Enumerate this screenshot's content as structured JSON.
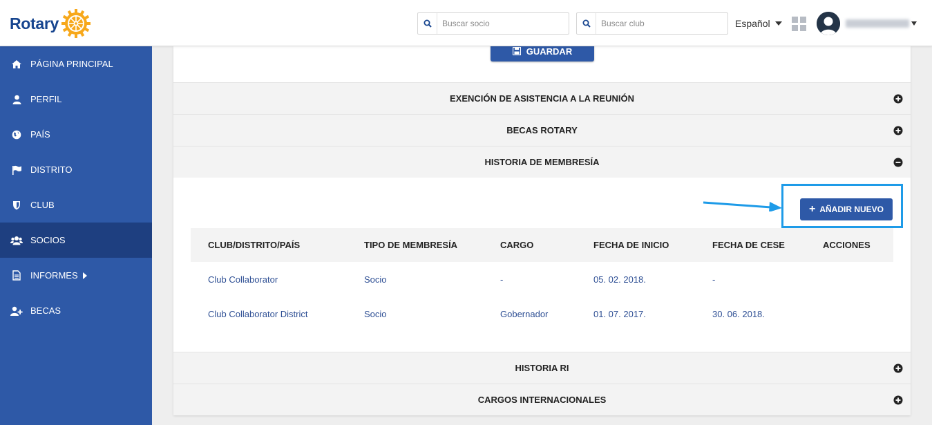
{
  "header": {
    "logo_text": "Rotary",
    "search_member_placeholder": "Buscar socio",
    "search_club_placeholder": "Buscar club",
    "language": "Español"
  },
  "sidebar": {
    "items": [
      {
        "label": "PÁGINA PRINCIPAL",
        "icon": "home-icon"
      },
      {
        "label": "PERFIL",
        "icon": "user-icon"
      },
      {
        "label": "PAÍS",
        "icon": "globe-icon"
      },
      {
        "label": "DISTRITO",
        "icon": "flag-icon"
      },
      {
        "label": "CLUB",
        "icon": "shield-icon"
      },
      {
        "label": "SOCIOS",
        "icon": "users-icon",
        "active": true
      },
      {
        "label": "INFORMES",
        "icon": "document-icon"
      },
      {
        "label": "BECAS",
        "icon": "user-plus-icon"
      }
    ]
  },
  "main": {
    "save_label": "GUARDAR",
    "sections": {
      "attendance": "EXENCIÓN DE ASISTENCIA A LA REUNIÓN",
      "grants": "BECAS ROTARY",
      "membership_history": "HISTORIA DE MEMBRESÍA",
      "ri_history": "HISTORIA RI",
      "international_roles": "CARGOS INTERNACIONALES"
    },
    "add_new_label": "AÑADIR NUEVO",
    "table": {
      "headers": [
        "CLUB/DISTRITO/PAÍS",
        "TIPO DE MEMBRESÍA",
        "CARGO",
        "FECHA DE INICIO",
        "FECHA DE CESE",
        "ACCIONES"
      ],
      "rows": [
        [
          "Club Collaborator",
          "Socio",
          "-",
          "05. 02. 2018.",
          "-",
          ""
        ],
        [
          "Club Collaborator District",
          "Socio",
          "Gobernador",
          "01. 07. 2017.",
          "30. 06. 2018.",
          ""
        ]
      ]
    }
  },
  "colors": {
    "brand_blue": "#2e59a7",
    "sidebar_active": "#1e3f80",
    "highlight": "#1e9be8",
    "logo_gold": "#f7a81b"
  }
}
